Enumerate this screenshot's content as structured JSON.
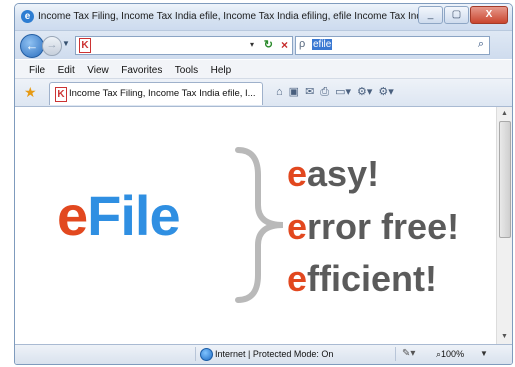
{
  "window": {
    "title": "Income Tax Filing, Income Tax India efile, Income Tax India efiling, efile Income Tax India, ef - Win...",
    "min_label": "_",
    "max_label": "▢",
    "close_label": "X"
  },
  "address": {
    "url_value": "",
    "favicon_glyph": "K",
    "dropdown_glyph": "▾",
    "refresh_glyph": "↻",
    "stop_glyph": "×",
    "search_value": "efile",
    "search_go_glyph": "⌕"
  },
  "menu": {
    "items": [
      "File",
      "Edit",
      "View",
      "Favorites",
      "Tools",
      "Help"
    ]
  },
  "tab": {
    "label": "Income Tax Filing, Income Tax India efile, I...",
    "favicon_glyph": "K"
  },
  "commands": {
    "home": "⌂",
    "feeds": "▣",
    "mail": "✉",
    "print": "⎙",
    "page": "Page",
    "safety": "Safety",
    "tools": "Tools"
  },
  "content": {
    "logo_e": "e",
    "logo_rest": "File",
    "lines": [
      {
        "e": "e",
        "rest": "asy!"
      },
      {
        "e": "e",
        "rest": "rror free!"
      },
      {
        "e": "e",
        "rest": "fficient!"
      }
    ]
  },
  "status": {
    "zone": "Internet | Protected Mode: On",
    "zoom": "100%",
    "zoom_glyph": "⌕"
  },
  "colors": {
    "accent_orange": "#e2481f",
    "accent_blue": "#2f8fe2",
    "tagline_gray": "#5b5b5b"
  }
}
